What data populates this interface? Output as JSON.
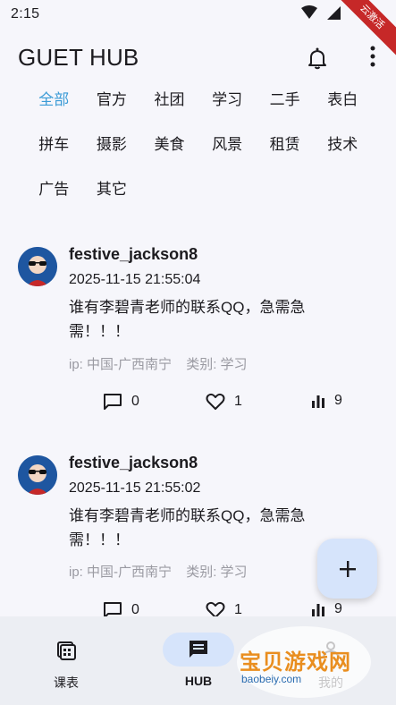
{
  "status_bar": {
    "time": "2:15"
  },
  "debug_banner": "云激活",
  "app_bar": {
    "title": "GUET HUB"
  },
  "categories": [
    {
      "label": "全部",
      "active": true
    },
    {
      "label": "官方"
    },
    {
      "label": "社团"
    },
    {
      "label": "学习"
    },
    {
      "label": "二手"
    },
    {
      "label": "表白"
    },
    {
      "label": "拼车"
    },
    {
      "label": "摄影"
    },
    {
      "label": "美食"
    },
    {
      "label": "风景"
    },
    {
      "label": "租赁"
    },
    {
      "label": "技术"
    },
    {
      "label": "广告"
    },
    {
      "label": "其它"
    }
  ],
  "posts": [
    {
      "username": "festive_jackson8",
      "time": "2025-11-15 21:55:04",
      "content": "谁有李碧青老师的联系QQ，急需急需！！！",
      "ip": "ip: 中国-广西南宁",
      "category": "类别: 学习",
      "comments": "0",
      "likes": "1",
      "views": "9"
    },
    {
      "username": "festive_jackson8",
      "time": "2025-11-15 21:55:02",
      "content": "谁有李碧青老师的联系QQ，急需急需！！！",
      "ip": "ip: 中国-广西南宁",
      "category": "类别: 学习",
      "comments": "0",
      "likes": "1",
      "views": "9"
    }
  ],
  "bottom_nav": [
    {
      "label": "课表",
      "icon": "schedule-icon"
    },
    {
      "label": "HUB",
      "icon": "chat-icon",
      "active": true
    },
    {
      "label": "我的",
      "icon": "person-icon"
    }
  ],
  "watermark": {
    "title": "宝贝游戏网",
    "url": "baobeiy.com"
  },
  "colors": {
    "accent": "#3b9bd6",
    "fab": "#d6e4fb",
    "nav_bg": "#eceef3",
    "background": "#f6f6fb"
  }
}
